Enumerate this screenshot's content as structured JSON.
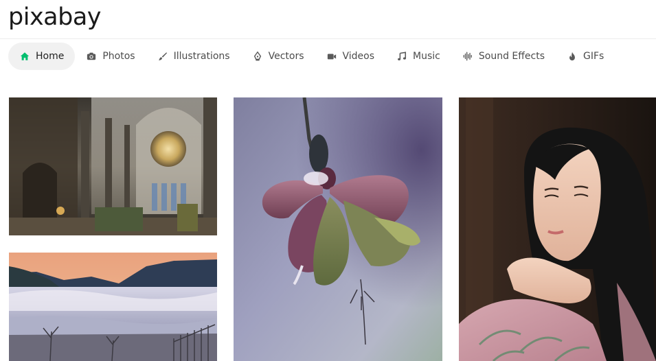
{
  "brand": {
    "logo_text": "pixabay"
  },
  "nav": {
    "items": [
      {
        "label": "Home",
        "icon": "home-icon",
        "active": true
      },
      {
        "label": "Photos",
        "icon": "camera-icon",
        "active": false
      },
      {
        "label": "Illustrations",
        "icon": "brush-icon",
        "active": false
      },
      {
        "label": "Vectors",
        "icon": "pen-nib-icon",
        "active": false
      },
      {
        "label": "Videos",
        "icon": "video-icon",
        "active": false
      },
      {
        "label": "Music",
        "icon": "music-note-icon",
        "active": false
      },
      {
        "label": "Sound Effects",
        "icon": "waveform-icon",
        "active": false
      },
      {
        "label": "GIFs",
        "icon": "flame-icon",
        "active": false
      }
    ]
  },
  "gallery": {
    "images": [
      {
        "subject": "cathedral-interior"
      },
      {
        "subject": "foggy-valley-sunrise"
      },
      {
        "subject": "purple-flower-closeup"
      },
      {
        "subject": "woman-portrait"
      }
    ]
  },
  "colors": {
    "accent_green": "#02be6e",
    "nav_active_bg": "#f1f1f1",
    "nav_text": "#4b4b4b"
  }
}
